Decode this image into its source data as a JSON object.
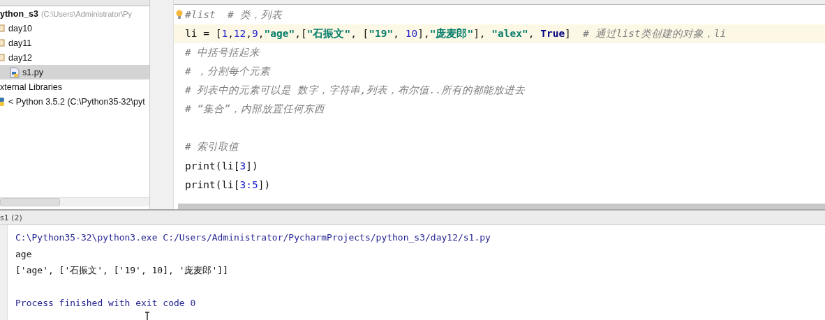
{
  "project_tree": [
    {
      "label": "ython_s3",
      "hint": "(C:\\Users\\Administrator\\Py",
      "kind": "project",
      "children": [
        {
          "label": "day10",
          "kind": "folder"
        },
        {
          "label": "day11",
          "kind": "folder"
        },
        {
          "label": "day12",
          "kind": "folder",
          "children": [
            {
              "label": "s1.py",
              "kind": "file",
              "selected": true
            }
          ]
        }
      ]
    },
    {
      "label": "xternal Libraries",
      "kind": "group",
      "children": [
        {
          "label": "< Python 3.5.2 (C:\\Python35-32\\pyt",
          "kind": "sdk"
        }
      ]
    }
  ],
  "editor": {
    "lines": [
      {
        "current": false,
        "tokens": [
          {
            "kind": "comment",
            "text": "#list  # 类，列表"
          }
        ]
      },
      {
        "current": true,
        "tokens": [
          {
            "kind": "plain",
            "text": "li = ["
          },
          {
            "kind": "number",
            "text": "1"
          },
          {
            "kind": "plain",
            "text": ","
          },
          {
            "kind": "number",
            "text": "12"
          },
          {
            "kind": "plain",
            "text": ","
          },
          {
            "kind": "number",
            "text": "9"
          },
          {
            "kind": "plain",
            "text": ","
          },
          {
            "kind": "string",
            "text": "\"age\""
          },
          {
            "kind": "plain",
            "text": ",["
          },
          {
            "kind": "string",
            "text": "\"石振文\""
          },
          {
            "kind": "plain",
            "text": ", ["
          },
          {
            "kind": "string",
            "text": "\"19\""
          },
          {
            "kind": "plain",
            "text": ", "
          },
          {
            "kind": "number",
            "text": "10"
          },
          {
            "kind": "plain",
            "text": "],"
          },
          {
            "kind": "string",
            "text": "\"庞麦郎\""
          },
          {
            "kind": "plain",
            "text": "], "
          },
          {
            "kind": "string",
            "text": "\"alex\""
          },
          {
            "kind": "plain",
            "text": ", "
          },
          {
            "kind": "keyword",
            "text": "True"
          },
          {
            "kind": "plain",
            "text": "]  "
          },
          {
            "kind": "comment",
            "text": "# 通过list类创建的对象，li"
          }
        ]
      },
      {
        "current": false,
        "tokens": [
          {
            "kind": "comment",
            "text": "# 中括号括起来"
          }
        ]
      },
      {
        "current": false,
        "tokens": [
          {
            "kind": "comment",
            "text": "# ，分割每个元素"
          }
        ]
      },
      {
        "current": false,
        "tokens": [
          {
            "kind": "comment",
            "text": "# 列表中的元素可以是 数字，字符串,列表，布尔值..所有的都能放进去"
          }
        ]
      },
      {
        "current": false,
        "tokens": [
          {
            "kind": "comment",
            "text": "# “集合”，内部放置任何东西"
          }
        ]
      },
      {
        "current": false
      },
      {
        "current": false,
        "tokens": [
          {
            "kind": "comment",
            "text": "# 索引取值"
          }
        ]
      },
      {
        "current": false,
        "tokens": [
          {
            "kind": "plain",
            "text": "print(li["
          },
          {
            "kind": "number",
            "text": "3"
          },
          {
            "kind": "plain",
            "text": "])"
          }
        ]
      },
      {
        "current": false,
        "tokens": [
          {
            "kind": "plain",
            "text": "print(li["
          },
          {
            "kind": "number",
            "text": "3:5"
          },
          {
            "kind": "plain",
            "text": "])"
          }
        ]
      }
    ]
  },
  "run_panel": {
    "title": "s1 (2)",
    "output": [
      {
        "kind": "command",
        "text": "C:\\Python35-32\\python3.exe C:/Users/Administrator/PycharmProjects/python_s3/day12/s1.py"
      },
      {
        "kind": "stdout",
        "text": "age"
      },
      {
        "kind": "stdout",
        "text": "['age', ['石振文', ['19', 10], '庞麦郎']]"
      },
      {
        "kind": "exit",
        "text": "Process finished with exit code 0"
      }
    ]
  }
}
